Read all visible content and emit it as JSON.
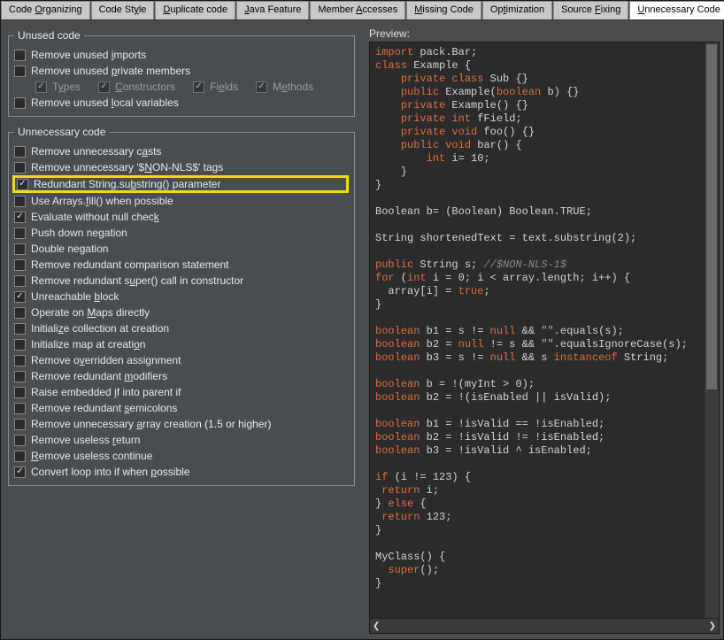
{
  "tabs": [
    {
      "pre": "Code ",
      "mn": "O",
      "post": "rganizing"
    },
    {
      "pre": "Code St",
      "mn": "y",
      "post": "le"
    },
    {
      "pre": "",
      "mn": "D",
      "post": "uplicate code"
    },
    {
      "pre": "",
      "mn": "J",
      "post": "ava Feature"
    },
    {
      "pre": "Member ",
      "mn": "A",
      "post": "ccesses"
    },
    {
      "pre": "",
      "mn": "M",
      "post": "issing Code"
    },
    {
      "pre": "Op",
      "mn": "t",
      "post": "imization"
    },
    {
      "pre": "Source ",
      "mn": "F",
      "post": "ixing"
    },
    {
      "pre": "",
      "mn": "U",
      "post": "nnecessary Code"
    }
  ],
  "active_tab": 8,
  "groups": {
    "unused": {
      "legend": "Unused code",
      "items": [
        {
          "pre": "Remove unused ",
          "mn": "i",
          "post": "mports",
          "checked": false
        },
        {
          "pre": "Remove unused ",
          "mn": "p",
          "post": "rivate members",
          "checked": false
        }
      ],
      "sub": [
        {
          "pre": "T",
          "mn": "y",
          "post": "pes"
        },
        {
          "pre": "",
          "mn": "C",
          "post": "onstructors"
        },
        {
          "pre": "Fi",
          "mn": "e",
          "post": "lds"
        },
        {
          "pre": "M",
          "mn": "e",
          "post": "thods"
        }
      ],
      "items2": [
        {
          "pre": "Remove unused ",
          "mn": "l",
          "post": "ocal variables",
          "checked": false
        }
      ]
    },
    "unnecessary": {
      "legend": "Unnecessary code",
      "items": [
        {
          "pre": "Remove unnecessary c",
          "mn": "a",
          "post": "sts",
          "checked": false
        },
        {
          "pre": "Remove unnecessary '$",
          "mn": "N",
          "post": "ON-NLS$' tags",
          "checked": false
        },
        {
          "pre": "Redundant String.su",
          "mn": "b",
          "post": "string() parameter",
          "checked": true,
          "highlight": true
        },
        {
          "pre": "Use Arrays.",
          "mn": "f",
          "post": "ill() when possible",
          "checked": false
        },
        {
          "pre": "Evaluate without null chec",
          "mn": "k",
          "post": "",
          "checked": true
        },
        {
          "pre": "Push down ne",
          "mn": "g",
          "post": "ation",
          "checked": false
        },
        {
          "pre": "Double ne",
          "mn": "g",
          "post": "ation",
          "checked": false
        },
        {
          "pre": "Remove redundant comparison statement",
          "mn": "",
          "post": "",
          "checked": false
        },
        {
          "pre": "Remove redundant s",
          "mn": "u",
          "post": "per() call in constructor",
          "checked": false
        },
        {
          "pre": "Unreachable ",
          "mn": "b",
          "post": "lock",
          "checked": true
        },
        {
          "pre": "Operate on ",
          "mn": "M",
          "post": "aps directly",
          "checked": false
        },
        {
          "pre": "Initiali",
          "mn": "z",
          "post": "e collection at creation",
          "checked": false
        },
        {
          "pre": "Initialize map at creati",
          "mn": "o",
          "post": "n",
          "checked": false
        },
        {
          "pre": "Remove o",
          "mn": "v",
          "post": "erridden assignment",
          "checked": false
        },
        {
          "pre": "Remove redundant ",
          "mn": "m",
          "post": "odifiers",
          "checked": false
        },
        {
          "pre": "Raise embedded ",
          "mn": "i",
          "post": "f into parent if",
          "checked": false
        },
        {
          "pre": "Remove redundant ",
          "mn": "s",
          "post": "emicolons",
          "checked": false
        },
        {
          "pre": "Remove unnecessary ",
          "mn": "a",
          "post": "rray creation (1.5 or higher)",
          "checked": false
        },
        {
          "pre": "Remove useless ",
          "mn": "r",
          "post": "eturn",
          "checked": false
        },
        {
          "pre": "",
          "mn": "R",
          "post": "emove useless continue",
          "checked": false
        },
        {
          "pre": "Convert loop into if when ",
          "mn": "p",
          "post": "ossible",
          "checked": true
        }
      ]
    }
  },
  "preview_label": "Preview:",
  "preview_code": [
    {
      "t": "import",
      "c": "kw"
    },
    {
      "t": " pack.Bar;\n"
    },
    {
      "t": "class",
      "c": "kw"
    },
    {
      "t": " Example {\n"
    },
    {
      "t": "    "
    },
    {
      "t": "private class",
      "c": "kw"
    },
    {
      "t": " Sub {}\n"
    },
    {
      "t": "    "
    },
    {
      "t": "public",
      "c": "kw"
    },
    {
      "t": " Example("
    },
    {
      "t": "boolean",
      "c": "kw"
    },
    {
      "t": " b) {}\n"
    },
    {
      "t": "    "
    },
    {
      "t": "private",
      "c": "kw"
    },
    {
      "t": " Example() {}\n"
    },
    {
      "t": "    "
    },
    {
      "t": "private int",
      "c": "kw"
    },
    {
      "t": " fField;\n"
    },
    {
      "t": "    "
    },
    {
      "t": "private void",
      "c": "kw"
    },
    {
      "t": " foo() {}\n"
    },
    {
      "t": "    "
    },
    {
      "t": "public void",
      "c": "kw"
    },
    {
      "t": " bar() {\n"
    },
    {
      "t": "        "
    },
    {
      "t": "int",
      "c": "kw"
    },
    {
      "t": " i= 10;\n"
    },
    {
      "t": "    }\n"
    },
    {
      "t": "}\n"
    },
    {
      "t": "\n"
    },
    {
      "t": "Boolean b= (Boolean) Boolean.TRUE;\n"
    },
    {
      "t": "\n"
    },
    {
      "t": "String shortenedText = text.substring(2);\n"
    },
    {
      "t": "\n"
    },
    {
      "t": "public",
      "c": "kw"
    },
    {
      "t": " String s; "
    },
    {
      "t": "//$NON-NLS-1$",
      "c": "cmt"
    },
    {
      "t": "\n"
    },
    {
      "t": "for",
      "c": "kw"
    },
    {
      "t": " ("
    },
    {
      "t": "int",
      "c": "kw"
    },
    {
      "t": " i = 0; i < array.length; i++) {\n"
    },
    {
      "t": "  array[i] = "
    },
    {
      "t": "true",
      "c": "kw"
    },
    {
      "t": ";\n"
    },
    {
      "t": "}\n"
    },
    {
      "t": "\n"
    },
    {
      "t": "boolean",
      "c": "kw"
    },
    {
      "t": " b1 = s != "
    },
    {
      "t": "null",
      "c": "kw"
    },
    {
      "t": " && "
    },
    {
      "t": "\"\"",
      "c": "str"
    },
    {
      "t": ".equals(s);\n"
    },
    {
      "t": "boolean",
      "c": "kw"
    },
    {
      "t": " b2 = "
    },
    {
      "t": "null",
      "c": "kw"
    },
    {
      "t": " != s && "
    },
    {
      "t": "\"\"",
      "c": "str"
    },
    {
      "t": ".equalsIgnoreCase(s);\n"
    },
    {
      "t": "boolean",
      "c": "kw"
    },
    {
      "t": " b3 = s != "
    },
    {
      "t": "null",
      "c": "kw"
    },
    {
      "t": " && s "
    },
    {
      "t": "instanceof",
      "c": "kw"
    },
    {
      "t": " String;\n"
    },
    {
      "t": "\n"
    },
    {
      "t": "boolean",
      "c": "kw"
    },
    {
      "t": " b = !(myInt > 0);\n"
    },
    {
      "t": "boolean",
      "c": "kw"
    },
    {
      "t": " b2 = !(isEnabled || isValid);\n"
    },
    {
      "t": "\n"
    },
    {
      "t": "boolean",
      "c": "kw"
    },
    {
      "t": " b1 = !isValid == !isEnabled;\n"
    },
    {
      "t": "boolean",
      "c": "kw"
    },
    {
      "t": " b2 = !isValid != !isEnabled;\n"
    },
    {
      "t": "boolean",
      "c": "kw"
    },
    {
      "t": " b3 = !isValid ^ isEnabled;\n"
    },
    {
      "t": "\n"
    },
    {
      "t": "if",
      "c": "kw"
    },
    {
      "t": " (i != 123) {\n"
    },
    {
      "t": " "
    },
    {
      "t": "return",
      "c": "kw"
    },
    {
      "t": " i;\n"
    },
    {
      "t": "} "
    },
    {
      "t": "else",
      "c": "kw"
    },
    {
      "t": " {\n"
    },
    {
      "t": " "
    },
    {
      "t": "return",
      "c": "kw"
    },
    {
      "t": " 123;\n"
    },
    {
      "t": "}\n"
    },
    {
      "t": "\n"
    },
    {
      "t": "MyClass() {\n"
    },
    {
      "t": "  "
    },
    {
      "t": "super",
      "c": "kw"
    },
    {
      "t": "();\n"
    },
    {
      "t": "}\n"
    }
  ]
}
